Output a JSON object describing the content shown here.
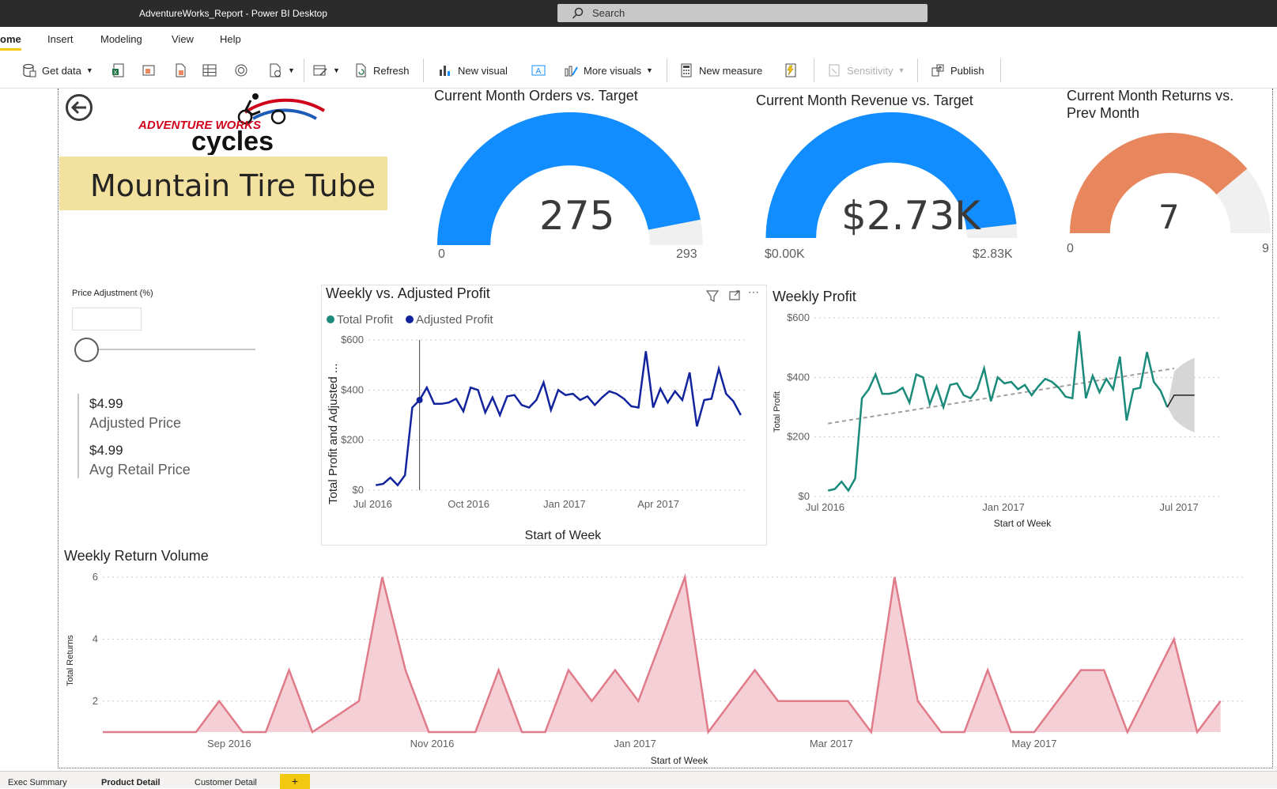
{
  "app": {
    "window_title": "AdventureWorks_Report - Power BI Desktop",
    "search_placeholder": "Search"
  },
  "menu": {
    "items": [
      "ome",
      "Insert",
      "Modeling",
      "View",
      "Help"
    ],
    "active_index": 0
  },
  "ribbon": {
    "get_data": "Get data",
    "refresh": "Refresh",
    "new_visual": "New visual",
    "more_visuals": "More visuals",
    "new_measure": "New measure",
    "sensitivity": "Sensitivity",
    "publish": "Publish"
  },
  "logo": {
    "line1": "ADVENTURE WORKS",
    "line2": "cycles"
  },
  "product_title": "Mountain Tire Tube",
  "gauges": [
    {
      "title": "Current Month Orders vs. Target",
      "value_label": "275",
      "min_label": "0",
      "max_label": "293",
      "fraction": 0.9386,
      "color": "#118dff"
    },
    {
      "title": "Current Month Revenue vs. Target",
      "value_label": "$2.73K",
      "min_label": "$0.00K",
      "max_label": "$2.83K",
      "fraction": 0.9647,
      "color": "#118dff"
    },
    {
      "title_line1": "Current Month Returns vs.",
      "title_line2": "Prev Month",
      "value_label": "7",
      "min_label": "0",
      "max_label": "9",
      "fraction": 0.7778,
      "color": "#e8875e"
    }
  ],
  "price_slider": {
    "label": "Price Adjustment (%)",
    "value_fraction": 0
  },
  "kpis": [
    {
      "value": "$4.99",
      "label": "Adjusted Price"
    },
    {
      "value": "$4.99",
      "label": "Avg Retail Price"
    }
  ],
  "tabs": {
    "items": [
      "Exec Summary",
      "Product Detail",
      "Customer Detail"
    ],
    "active_index": 1,
    "add_label": "+"
  },
  "colors": {
    "accent": "#f2c811",
    "blue": "#118dff",
    "navy": "#12239e",
    "teal": "#1a8a7a",
    "pink_line": "#e07b8a",
    "pink_fill": "#f4cfd5"
  },
  "chart_data": [
    {
      "type": "line",
      "title": "Weekly vs. Adjusted Profit",
      "xlabel": "Start of Week",
      "ylabel": "Total Profit and Adjusted ...",
      "legend": [
        "Total Profit",
        "Adjusted Profit"
      ],
      "legend_colors": [
        "#1a8a7a",
        "#12239e"
      ],
      "x_ticks": [
        "Jul 2016",
        "Oct 2016",
        "Jan 2017",
        "Apr 2017"
      ],
      "y_ticks": [
        "$0",
        "$200",
        "$400",
        "$600"
      ],
      "ylim": [
        0,
        600
      ],
      "x_range": [
        "2016-06-27",
        "2017-06-26"
      ],
      "series": [
        {
          "name": "Adjusted Profit",
          "x": [
            "2016-07-04",
            "2016-07-11",
            "2016-07-18",
            "2016-07-25",
            "2016-08-01",
            "2016-08-08",
            "2016-08-15",
            "2016-08-22",
            "2016-08-29",
            "2016-09-05",
            "2016-09-12",
            "2016-09-19",
            "2016-09-26",
            "2016-10-03",
            "2016-10-10",
            "2016-10-17",
            "2016-10-24",
            "2016-10-31",
            "2016-11-07",
            "2016-11-14",
            "2016-11-21",
            "2016-11-28",
            "2016-12-05",
            "2016-12-12",
            "2016-12-19",
            "2016-12-26",
            "2017-01-02",
            "2017-01-09",
            "2017-01-16",
            "2017-01-23",
            "2017-01-30",
            "2017-02-06",
            "2017-02-13",
            "2017-02-20",
            "2017-02-27",
            "2017-03-06",
            "2017-03-13",
            "2017-03-20",
            "2017-03-27",
            "2017-04-03",
            "2017-04-10",
            "2017-04-17",
            "2017-04-24",
            "2017-05-01",
            "2017-05-08",
            "2017-05-15",
            "2017-05-22",
            "2017-05-29",
            "2017-06-05",
            "2017-06-12",
            "2017-06-19"
          ],
          "values": [
            20,
            25,
            50,
            20,
            60,
            330,
            360,
            410,
            345,
            345,
            350,
            365,
            315,
            410,
            400,
            310,
            370,
            300,
            375,
            380,
            340,
            330,
            360,
            430,
            320,
            400,
            380,
            385,
            360,
            375,
            340,
            370,
            395,
            385,
            365,
            335,
            330,
            555,
            330,
            405,
            350,
            395,
            360,
            470,
            255,
            360,
            365,
            485,
            385,
            355,
            300
          ]
        }
      ]
    },
    {
      "type": "line",
      "title": "Weekly Profit",
      "xlabel": "Start of Week",
      "ylabel": "Total Profit",
      "x_ticks": [
        "Jul 2016",
        "Jan 2017",
        "Jul 2017"
      ],
      "y_ticks": [
        "$0",
        "$200",
        "$400",
        "$600"
      ],
      "ylim": [
        0,
        600
      ],
      "x_range": [
        "2016-06-20",
        "2017-08-14"
      ],
      "series": [
        {
          "name": "Total Profit",
          "x": [
            "2016-07-04",
            "2016-07-11",
            "2016-07-18",
            "2016-07-25",
            "2016-08-01",
            "2016-08-08",
            "2016-08-15",
            "2016-08-22",
            "2016-08-29",
            "2016-09-05",
            "2016-09-12",
            "2016-09-19",
            "2016-09-26",
            "2016-10-03",
            "2016-10-10",
            "2016-10-17",
            "2016-10-24",
            "2016-10-31",
            "2016-11-07",
            "2016-11-14",
            "2016-11-21",
            "2016-11-28",
            "2016-12-05",
            "2016-12-12",
            "2016-12-19",
            "2016-12-26",
            "2017-01-02",
            "2017-01-09",
            "2017-01-16",
            "2017-01-23",
            "2017-01-30",
            "2017-02-06",
            "2017-02-13",
            "2017-02-20",
            "2017-02-27",
            "2017-03-06",
            "2017-03-13",
            "2017-03-20",
            "2017-03-27",
            "2017-04-03",
            "2017-04-10",
            "2017-04-17",
            "2017-04-24",
            "2017-05-01",
            "2017-05-08",
            "2017-05-15",
            "2017-05-22",
            "2017-05-29",
            "2017-06-05",
            "2017-06-12",
            "2017-06-19"
          ],
          "values": [
            20,
            25,
            50,
            20,
            60,
            330,
            360,
            410,
            345,
            345,
            350,
            365,
            315,
            410,
            400,
            310,
            370,
            300,
            375,
            380,
            340,
            330,
            360,
            430,
            320,
            400,
            380,
            385,
            360,
            375,
            340,
            370,
            395,
            385,
            365,
            335,
            330,
            555,
            330,
            405,
            350,
            395,
            360,
            470,
            255,
            360,
            365,
            485,
            385,
            355,
            300
          ]
        },
        {
          "name": "Forecast",
          "x": [
            "2017-06-19",
            "2017-06-26",
            "2017-07-03",
            "2017-07-10",
            "2017-07-17"
          ],
          "values": [
            300,
            340,
            340,
            340,
            340
          ],
          "upper": [
            300,
            420,
            440,
            455,
            465
          ],
          "lower": [
            300,
            260,
            240,
            225,
            215
          ]
        },
        {
          "name": "Trend",
          "x": [
            "2016-07-04",
            "2017-06-26"
          ],
          "values": [
            245,
            430
          ]
        }
      ]
    },
    {
      "type": "area",
      "title": "Weekly Return Volume",
      "xlabel": "Start of Week",
      "ylabel": "Total Returns",
      "x_ticks": [
        "Sep 2016",
        "Nov 2016",
        "Jan 2017",
        "Mar 2017",
        "May 2017"
      ],
      "y_ticks": [
        "2",
        "4",
        "6"
      ],
      "ylim": [
        1,
        6
      ],
      "x_range": [
        "2016-07-25",
        "2017-07-03"
      ],
      "series": [
        {
          "name": "Total Returns",
          "x": [
            "2016-07-25",
            "2016-08-01",
            "2016-08-08",
            "2016-08-15",
            "2016-08-22",
            "2016-08-29",
            "2016-09-05",
            "2016-09-12",
            "2016-09-19",
            "2016-09-26",
            "2016-10-03",
            "2016-10-10",
            "2016-10-17",
            "2016-10-24",
            "2016-10-31",
            "2016-11-07",
            "2016-11-14",
            "2016-11-21",
            "2016-11-28",
            "2016-12-05",
            "2016-12-12",
            "2016-12-19",
            "2016-12-26",
            "2017-01-02",
            "2017-01-09",
            "2017-01-16",
            "2017-01-23",
            "2017-01-30",
            "2017-02-06",
            "2017-02-13",
            "2017-02-20",
            "2017-02-27",
            "2017-03-06",
            "2017-03-13",
            "2017-03-20",
            "2017-03-27",
            "2017-04-03",
            "2017-04-10",
            "2017-04-17",
            "2017-04-24",
            "2017-05-01",
            "2017-05-08",
            "2017-05-15",
            "2017-05-22",
            "2017-05-29",
            "2017-06-05",
            "2017-06-12",
            "2017-06-19",
            "2017-06-26"
          ],
          "values": [
            1,
            1,
            1,
            1,
            1,
            2,
            1,
            1,
            3,
            1,
            1.5,
            2,
            6,
            3,
            1,
            1,
            1,
            3,
            1,
            1,
            3,
            2,
            3,
            2,
            4,
            6,
            1,
            2,
            3,
            2,
            2,
            2,
            2,
            1,
            6,
            2,
            1,
            1,
            3,
            1,
            1,
            2,
            3,
            3,
            1,
            2.5,
            4,
            1,
            2
          ]
        }
      ]
    }
  ]
}
